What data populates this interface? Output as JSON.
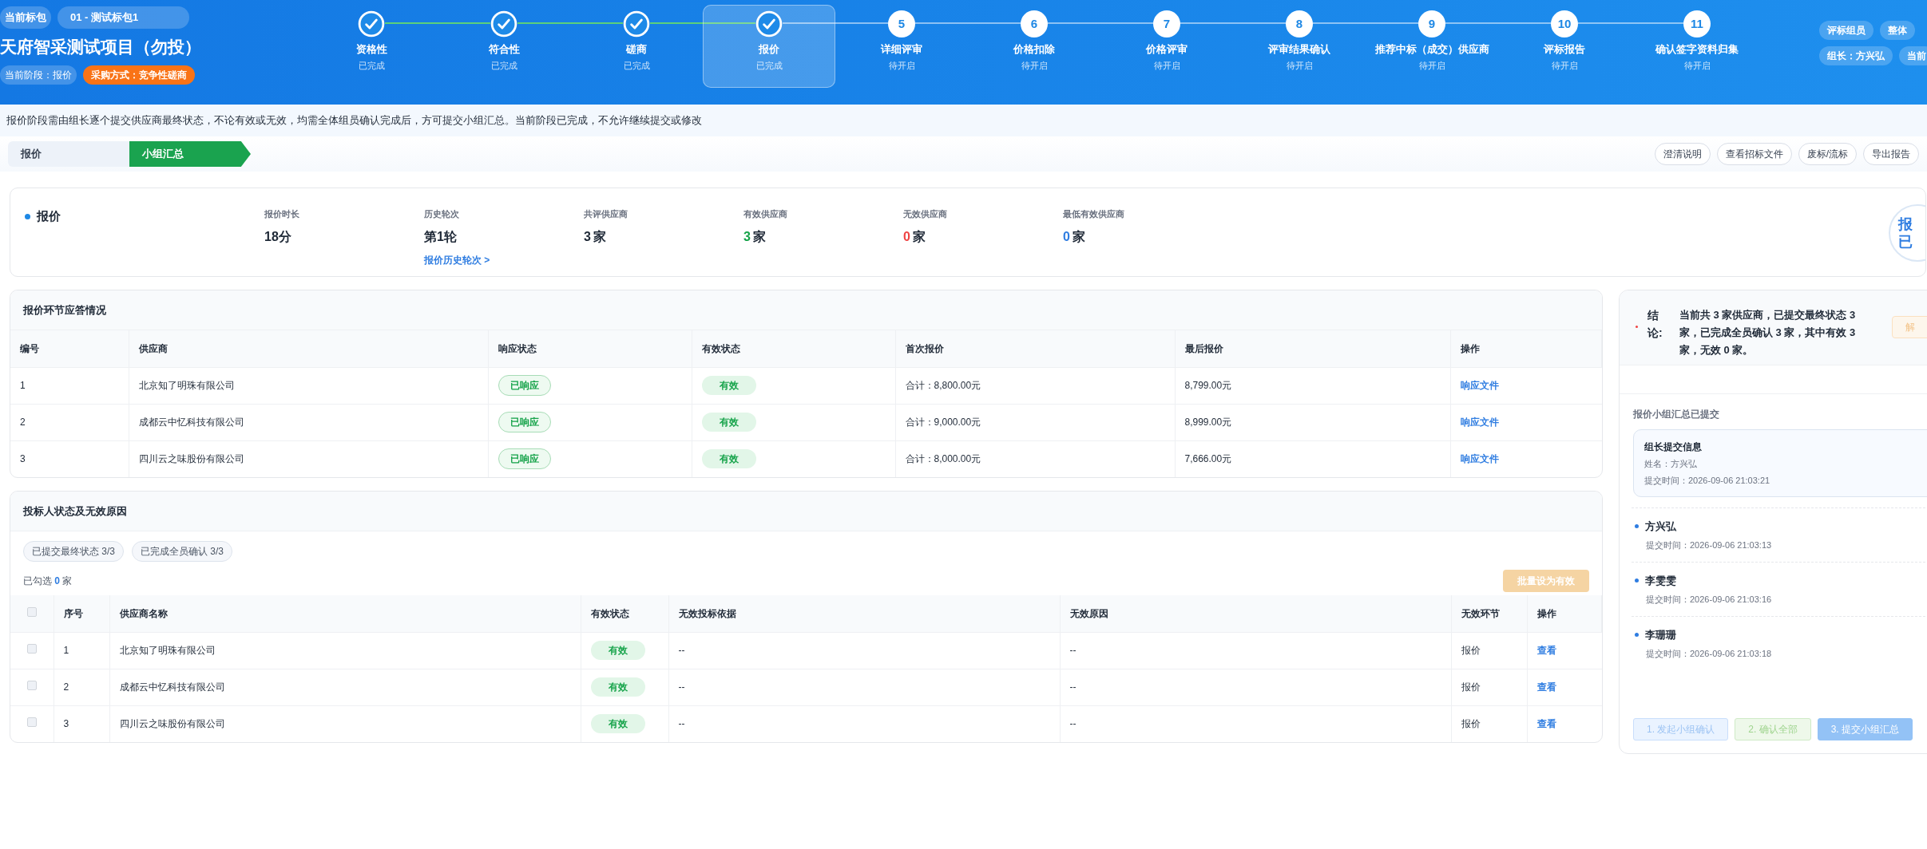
{
  "header": {
    "package_label": "当前标包",
    "package_name": "01 - 测试标包1",
    "project_title": "天府智采测试项目（勿投）",
    "current_stage": "当前阶段：报价",
    "procurement_method": "采购方式：竞争性磋商",
    "steps": [
      {
        "kind": "done",
        "label": "资格性",
        "status": "已完成",
        "selected": false
      },
      {
        "kind": "done",
        "label": "符合性",
        "status": "已完成",
        "selected": false
      },
      {
        "kind": "done",
        "label": "磋商",
        "status": "已完成",
        "selected": false
      },
      {
        "kind": "done",
        "label": "报价",
        "status": "已完成",
        "selected": true
      },
      {
        "kind": "pending",
        "number": "5",
        "label": "详细评审",
        "status": "待开启",
        "selected": false
      },
      {
        "kind": "pending",
        "number": "6",
        "label": "价格扣除",
        "status": "待开启",
        "selected": false
      },
      {
        "kind": "pending",
        "number": "7",
        "label": "价格评审",
        "status": "待开启",
        "selected": false
      },
      {
        "kind": "pending",
        "number": "8",
        "label": "评审结果确认",
        "status": "待开启",
        "selected": false
      },
      {
        "kind": "pending",
        "number": "9",
        "label": "推荐中标（成交）供应商",
        "status": "待开启",
        "selected": false
      },
      {
        "kind": "pending",
        "number": "10",
        "label": "评标报告",
        "status": "待开启",
        "selected": false
      },
      {
        "kind": "pending",
        "number": "11",
        "label": "确认签字资料归集",
        "status": "待开启",
        "selected": false
      }
    ],
    "role_badges": [
      [
        "评标组员",
        "整体"
      ],
      [
        "组长：方兴弘",
        "当前"
      ]
    ]
  },
  "notice": "报价阶段需由组长逐个提交供应商最终状态，不论有效或无效，均需全体组员确认完成后，方可提交小组汇总。当前阶段已完成，不允许继续提交或修改",
  "tabs": [
    {
      "label": "报价",
      "selected": false
    },
    {
      "label": "小组汇总",
      "selected": true
    }
  ],
  "actions": [
    "澄清说明",
    "查看招标文件",
    "废标/流标",
    "导出报告"
  ],
  "stage_summary": {
    "title": "报价",
    "stats": [
      {
        "label": "报价时长",
        "value": "18分"
      },
      {
        "label": "历史轮次",
        "value": "第1轮",
        "link": "报价历史轮次 >"
      },
      {
        "label": "共评供应商",
        "value": "3",
        "unit": "家"
      },
      {
        "label": "有效供应商",
        "value": "3",
        "unit": "家",
        "color": "#16a34a"
      },
      {
        "label": "无效供应商",
        "value": "0",
        "unit": "家",
        "color": "#ef4444"
      },
      {
        "label": "最低有效供应商",
        "value": "0",
        "unit": "家",
        "color": "#2f7de1"
      }
    ],
    "badge": [
      "报",
      "已"
    ]
  },
  "response_table": {
    "title": "报价环节应答情况",
    "columns": [
      "编号",
      "供应商",
      "响应状态",
      "有效状态",
      "首次报价",
      "最后报价",
      "操作"
    ],
    "rows": [
      {
        "no": "1",
        "supplier": "北京知了明珠有限公司",
        "response": "已响应",
        "valid": "有效",
        "first": "合计：8,800.00元",
        "last": "8,799.00元",
        "action": "响应文件"
      },
      {
        "no": "2",
        "supplier": "成都云中忆科技有限公司",
        "response": "已响应",
        "valid": "有效",
        "first": "合计：9,000.00元",
        "last": "8,999.00元",
        "action": "响应文件"
      },
      {
        "no": "3",
        "supplier": "四川云之味股份有限公司",
        "response": "已响应",
        "valid": "有效",
        "first": "合计：8,000.00元",
        "last": "7,666.00元",
        "action": "响应文件"
      }
    ]
  },
  "bidder_table": {
    "title": "投标人状态及无效原因",
    "chips": [
      "已提交最终状态 3/3",
      "已完成全员确认 3/3"
    ],
    "select_all_checked": false,
    "selected_prefix": "已勾选",
    "selected_count": "0",
    "selected_suffix": "家",
    "batch_button": "批量设为有效",
    "columns": [
      "序号",
      "供应商名称",
      "有效状态",
      "无效投标依据",
      "无效原因",
      "无效环节",
      "操作"
    ],
    "rows": [
      {
        "checked": false,
        "no": "1",
        "supplier": "北京知了明珠有限公司",
        "valid": "有效",
        "basis": "--",
        "reason": "--",
        "stage": "报价",
        "action": "查看"
      },
      {
        "checked": false,
        "no": "2",
        "supplier": "成都云中忆科技有限公司",
        "valid": "有效",
        "basis": "--",
        "reason": "--",
        "stage": "报价",
        "action": "查看"
      },
      {
        "checked": false,
        "no": "3",
        "supplier": "四川云之味股份有限公司",
        "valid": "有效",
        "basis": "--",
        "reason": "--",
        "stage": "报价",
        "action": "查看"
      }
    ]
  },
  "summary_panel": {
    "conclusion_label": "结论:",
    "conclusion": "当前共 3 家供应商，已提交最终状态 3 家，已完成全员确认 3 家，其中有效 3 家，无效 0 家。",
    "unlock_button": "解",
    "submitted_title": "报价小组汇总已提交",
    "leader": {
      "title": "组长提交信息",
      "name": "姓名：方兴弘",
      "time": "提交时间：2026-09-06 21:03:21"
    },
    "members": [
      {
        "name": "方兴弘",
        "time": "提交时间：2026-09-06 21:03:13"
      },
      {
        "name": "李雯雯",
        "time": "提交时间：2026-09-06 21:03:16"
      },
      {
        "name": "李珊珊",
        "time": "提交时间：2026-09-06 21:03:18"
      }
    ],
    "buttons": [
      {
        "label": "1. 发起小组确认",
        "kind": "blue-light"
      },
      {
        "label": "2. 确认全部",
        "kind": "green-light"
      },
      {
        "label": "3. 提交小组汇总",
        "kind": "blue"
      }
    ]
  }
}
